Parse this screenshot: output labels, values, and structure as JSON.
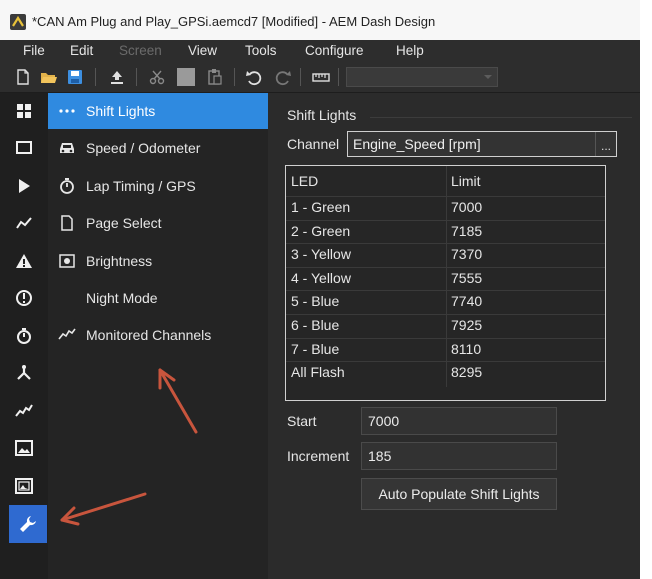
{
  "window": {
    "title": "*CAN Am Plug and Play_GPSi.aemcd7 [Modified] - AEM Dash Design"
  },
  "menu": [
    {
      "label": "File",
      "enabled": true
    },
    {
      "label": "Edit",
      "enabled": true
    },
    {
      "label": "Screen",
      "enabled": false
    },
    {
      "label": "View",
      "enabled": true
    },
    {
      "label": "Tools",
      "enabled": true
    },
    {
      "label": "Configure",
      "enabled": true
    },
    {
      "label": "Help",
      "enabled": true
    }
  ],
  "toolbar": {
    "icons": [
      "new-file-icon",
      "open-folder-icon",
      "save-icon",
      "upload-icon",
      "cut-icon",
      "copy-icon",
      "paste-icon",
      "undo-icon",
      "redo-icon",
      "ruler-icon"
    ],
    "combo_value": ""
  },
  "iconbar": {
    "icons": [
      "grid-icon",
      "screen-icon",
      "play-icon",
      "line-graph-icon",
      "warning-icon",
      "alert-circle-icon",
      "stopwatch-icon",
      "network-icon",
      "trend-icon",
      "image-icon",
      "picture-icon",
      "wrench-icon"
    ],
    "active": "wrench-icon"
  },
  "nav": {
    "items": [
      {
        "label": "Shift Lights",
        "icon": "dots-icon",
        "selected": true
      },
      {
        "label": "Speed / Odometer",
        "icon": "car-icon",
        "selected": false
      },
      {
        "label": "Lap Timing / GPS",
        "icon": "stopwatch-icon",
        "selected": false
      },
      {
        "label": "Page Select",
        "icon": "page-icon",
        "selected": false
      },
      {
        "label": "Brightness",
        "icon": "brightness-icon",
        "selected": false
      },
      {
        "label": "Night Mode",
        "icon": "moon-icon",
        "selected": false
      },
      {
        "label": "Monitored Channels",
        "icon": "trend-icon",
        "selected": false
      }
    ]
  },
  "shift_lights": {
    "group_title": "Shift Lights",
    "channel_label": "Channel",
    "channel_value": "Engine_Speed [rpm]",
    "channel_button": "...",
    "table": {
      "columns": [
        "LED",
        "Limit"
      ],
      "rows": [
        [
          "1 - Green",
          "7000"
        ],
        [
          "2 - Green",
          "7185"
        ],
        [
          "3 - Yellow",
          "7370"
        ],
        [
          "4 - Yellow",
          "7555"
        ],
        [
          "5 - Blue",
          "7740"
        ],
        [
          "6 - Blue",
          "7925"
        ],
        [
          "7 - Blue",
          "8110"
        ],
        [
          "All Flash",
          "8295"
        ]
      ]
    },
    "start_label": "Start",
    "start_value": "7000",
    "increment_label": "Increment",
    "increment_value": "185",
    "auto_populate_label": "Auto Populate Shift Lights"
  },
  "colors": {
    "selection_blue": "#2f8ae0",
    "active_icon_blue": "#2f6ad0",
    "annotation_arrow": "#c8553d",
    "background_dark": "#2b2b2b"
  }
}
